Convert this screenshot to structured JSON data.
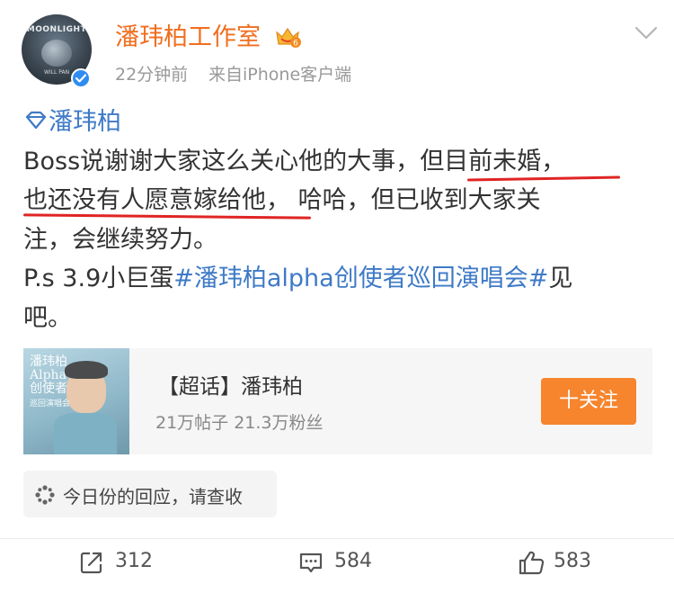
{
  "header": {
    "user_name": "潘玮柏工作室",
    "time": "22分钟前",
    "source": "来自iPhone客户端",
    "avatar_text_top": "MOONLIGHT",
    "avatar_text_bottom": "WILL PAN",
    "badge_icon": "vip-crown-icon",
    "verified_icon": "verified-check-icon",
    "more_icon": "chevron-down-icon"
  },
  "post": {
    "topic": "潘玮柏",
    "line1_a": "Boss说谢谢大家这么关心他的大事，",
    "line1_b": "但目前未婚",
    "line1_c": "，",
    "line2_a": "也还没有人愿意嫁给他",
    "line2_b": "，",
    "line2_c": " 哈哈，但已收到大家关",
    "line3": "注，会继续努力。",
    "line4_a": "P.s  3.9小巨蛋",
    "line4_hashtag": "#潘玮柏alpha创使者巡回演唱会#",
    "line4_b": "见",
    "line5": "吧。",
    "link_color": "#3e7ac7",
    "underline_color": "#e02424"
  },
  "card": {
    "cover_text": "潘玮柏\nAlpha\n创使者\n巡回演唱会",
    "title": "【超话】潘玮柏",
    "stats": "21万帖子 21.3万粉丝",
    "follow_label": "十关注",
    "accent": "#f6852e"
  },
  "reply_chip": {
    "label": "今日份的回应，请查收",
    "icon": "sparkle-icon"
  },
  "actions": {
    "repost": "312",
    "comment": "584",
    "like": "583"
  },
  "colors": {
    "name": "#f06e1f",
    "meta": "#999999"
  }
}
